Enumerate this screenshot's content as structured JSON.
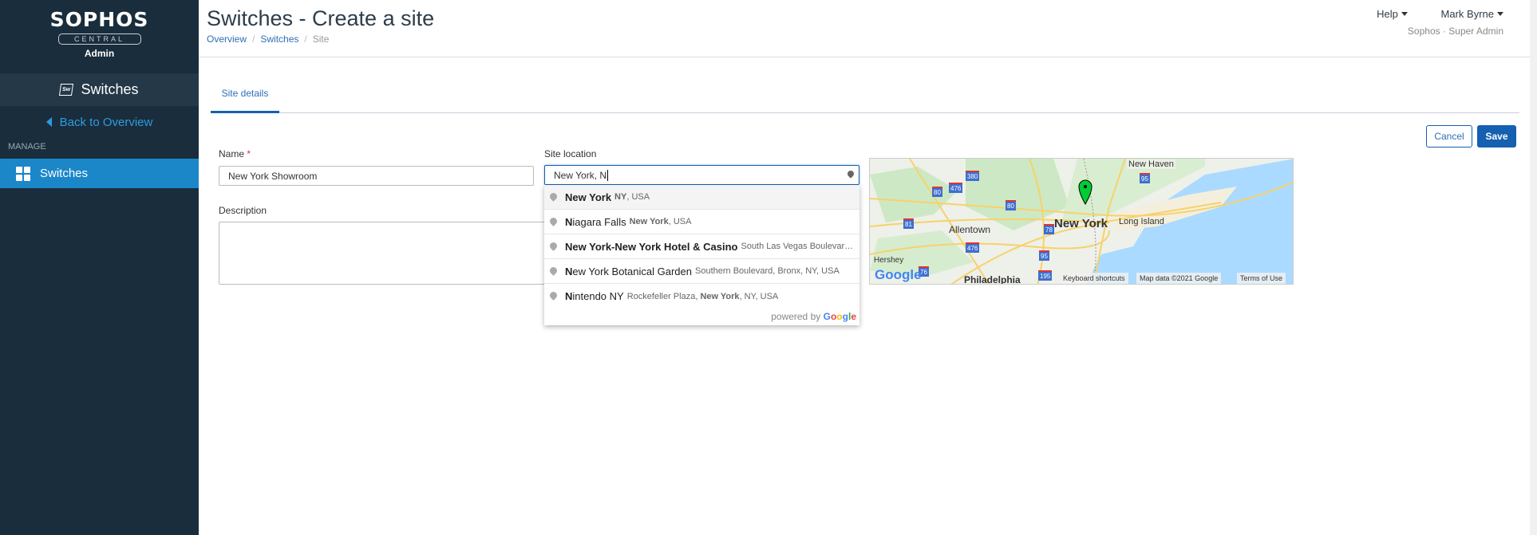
{
  "sidebar": {
    "brand": "SOPHOS",
    "central": "CENTRAL",
    "admin": "Admin",
    "product": "Switches",
    "product_icon_text": "Sw",
    "back": "Back to Overview",
    "section": "MANAGE",
    "items": [
      {
        "label": "Switches",
        "active": true
      }
    ]
  },
  "header": {
    "title": "Switches - Create a site",
    "breadcrumb": [
      "Overview",
      "Switches",
      "Site"
    ],
    "help": "Help",
    "user": "Mark Byrne",
    "org": "Sophos · Super Admin"
  },
  "tabs": [
    {
      "label": "Site details",
      "active": true
    }
  ],
  "actions": {
    "cancel": "Cancel",
    "save": "Save"
  },
  "form": {
    "name_label": "Name",
    "required_mark": "*",
    "name_value": "New York Showroom",
    "location_label": "Site location",
    "location_value": "New York, N",
    "description_label": "Description",
    "description_value": ""
  },
  "suggestions": [
    {
      "main_bold": "New York",
      "main_rest": "",
      "sub_pre": "",
      "sub_bold": "NY",
      "sub_post": ", USA"
    },
    {
      "main_bold": "N",
      "main_rest": "iagara Falls",
      "sub_pre": "",
      "sub_bold": "New York",
      "sub_post": ", USA"
    },
    {
      "main_bold": "New York-New York Hotel & Casino",
      "main_rest": "",
      "sub_pre": "South Las Vegas Boulevar…",
      "sub_bold": "",
      "sub_post": ""
    },
    {
      "main_bold": "N",
      "main_rest": "ew York Botanical Garden",
      "sub_pre": "Southern Boulevard, Bronx, NY, USA",
      "sub_bold": "",
      "sub_post": ""
    },
    {
      "main_bold": "N",
      "main_rest": "intendo NY",
      "sub_pre": "Rockefeller Plaza, ",
      "sub_bold": "New York",
      "sub_post": ", NY, USA"
    }
  ],
  "powered_by": "powered by",
  "google": [
    "G",
    "o",
    "o",
    "g",
    "l",
    "e"
  ],
  "map": {
    "labels": {
      "new_york": "New York",
      "long_island": "Long Island",
      "allentown": "Allentown",
      "hershey": "Hershey",
      "philadelphia": "Philadelphia",
      "new_haven": "New Haven"
    },
    "shields": [
      "380",
      "476",
      "80",
      "80",
      "81",
      "476",
      "78",
      "95",
      "95",
      "76",
      "195"
    ],
    "keyboard": "Keyboard shortcuts",
    "map_data": "Map data ©2021 Google",
    "terms": "Terms of Use",
    "google_logo": "Google"
  }
}
